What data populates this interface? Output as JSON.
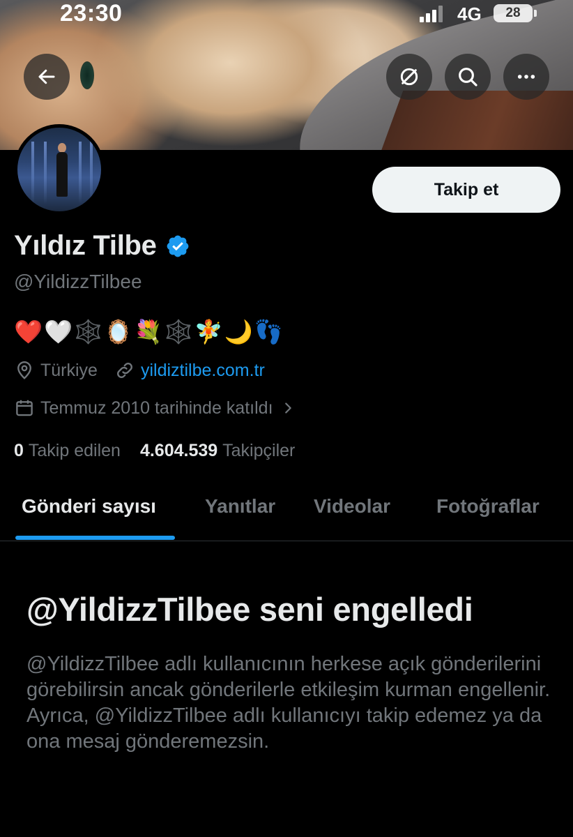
{
  "status_bar": {
    "time": "23:30",
    "network": "4G",
    "battery": "28"
  },
  "header_actions": {
    "back_icon": "arrow-left-icon",
    "grok_icon": "slashed-circle-icon",
    "search_icon": "search-icon",
    "more_icon": "more-horizontal-icon"
  },
  "profile": {
    "follow_label": "Takip et",
    "display_name": "Yıldız Tilbe",
    "verified": true,
    "handle": "@YildizzTilbee",
    "bio": "❤️🤍🕸️🪞💐🕸️🧚🌙👣",
    "location": "Türkiye",
    "website": "yildiztilbe.com.tr",
    "joined": "Temmuz 2010 tarihinde katıldı",
    "following_count": "0",
    "following_label": "Takip edilen",
    "followers_count": "4.604.539",
    "followers_label": "Takipçiler"
  },
  "tabs": [
    {
      "label": "Gönderi sayısı",
      "active": true
    },
    {
      "label": "Yanıtlar",
      "active": false
    },
    {
      "label": "Videolar",
      "active": false
    },
    {
      "label": "Fotoğraflar",
      "active": false
    }
  ],
  "blocked": {
    "title": "@YildizzTilbee seni engelledi",
    "body": "@YildizzTilbee adlı kullanıcının herkese açık gönderilerini görebilirsin ancak gönderilerle etkileşim kurman engellenir. Ayrıca, @YildizzTilbee adlı kullanıcıyı takip edemez ya da ona mesaj gönderemezsin."
  },
  "colors": {
    "accent": "#1d9bf0",
    "background": "#000000",
    "text_primary": "#e7e9ea",
    "text_secondary": "#71767b",
    "follow_button_bg": "#eff3f4"
  }
}
